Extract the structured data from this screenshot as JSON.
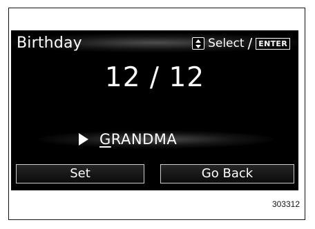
{
  "header": {
    "title": "Birthday",
    "select_label": "Select",
    "separator": "/",
    "enter_key": "ENTER"
  },
  "entry": {
    "date": "12 / 12",
    "name_first_letter": "G",
    "name_rest": "RANDMA"
  },
  "buttons": {
    "set": "Set",
    "go_back": "Go Back"
  },
  "figure_code": "303312",
  "icons": {
    "selector": "up-down-arrows-icon",
    "cursor": "play-triangle-icon"
  }
}
